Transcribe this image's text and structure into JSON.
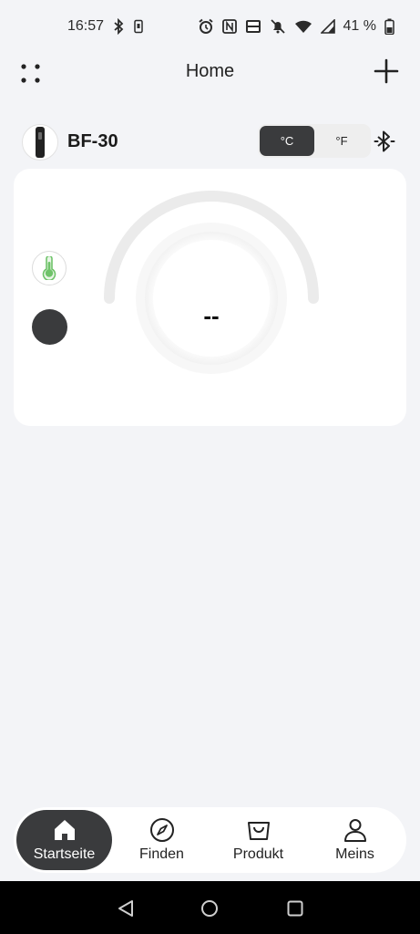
{
  "status_bar": {
    "time": "16:57",
    "battery_percent": "41 %",
    "icons": [
      "bluetooth-icon",
      "phone-icon",
      "alarm-icon",
      "nfc-icon",
      "volte-icon",
      "mute-icon",
      "wifi-icon",
      "signal-icon",
      "battery-icon"
    ]
  },
  "header": {
    "title": "Home",
    "left_icon": "grid-menu-icon",
    "right_icon": "plus-icon"
  },
  "device": {
    "name": "BF-30",
    "units": [
      {
        "label": "°C",
        "selected": true
      },
      {
        "label": "°F",
        "selected": false
      }
    ],
    "connection_icon": "bluetooth-icon"
  },
  "card": {
    "temperature": "--",
    "probe_icon": "thermometer-icon"
  },
  "bottom_nav": {
    "items": [
      {
        "label": "Startseite",
        "icon": "home-icon",
        "active": true
      },
      {
        "label": "Finden",
        "icon": "compass-icon",
        "active": false
      },
      {
        "label": "Produkt",
        "icon": "bag-icon",
        "active": false
      },
      {
        "label": "Meins",
        "icon": "person-icon",
        "active": false
      }
    ]
  },
  "colors": {
    "background": "#f3f4f7",
    "card": "#ffffff",
    "accent_dark": "#3a3b3d",
    "probe_green": "#6fc36a",
    "gauge_track": "#e9e9e9"
  }
}
